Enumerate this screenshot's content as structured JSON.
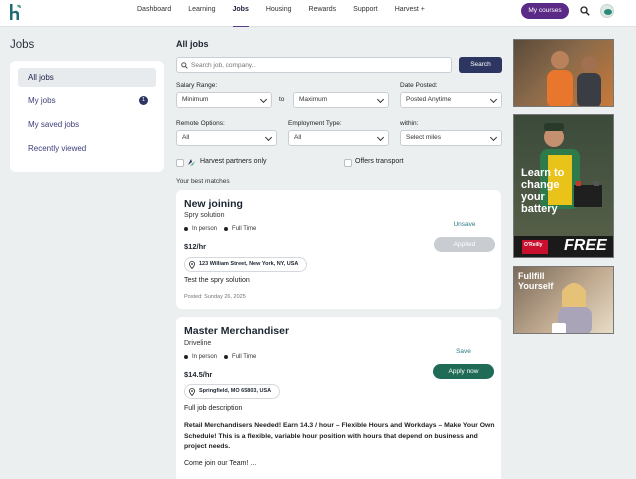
{
  "nav": {
    "items": [
      "Dashboard",
      "Learning",
      "Jobs",
      "Housing",
      "Rewards",
      "Support",
      "Harvest +"
    ],
    "active": "Jobs",
    "my_courses": "My courses"
  },
  "sidebar": {
    "title": "Jobs",
    "items": [
      {
        "label": "All jobs"
      },
      {
        "label": "My jobs",
        "badge": "1"
      },
      {
        "label": "My saved jobs"
      },
      {
        "label": "Recently viewed"
      }
    ]
  },
  "main": {
    "title": "All jobs",
    "search": {
      "placeholder": "Search job, company..",
      "button": "Search"
    },
    "filters": {
      "salary_label": "Salary Range:",
      "salary_min": "Minimum",
      "salary_to": "to",
      "salary_max": "Maximum",
      "date_label": "Date Posted:",
      "date_value": "Posted Anytime",
      "remote_label": "Remote Options:",
      "remote_value": "All",
      "employment_label": "Employment Type:",
      "employment_value": "All",
      "within_label": "within:",
      "within_value": "Select miles",
      "harvest_partners": "Harvest partners only",
      "offers_transport": "Offers transport"
    },
    "best_matches": "Your best matches",
    "jobs": [
      {
        "title": "New joining",
        "company": "Spry solution",
        "tags": [
          "In person",
          "Full Time"
        ],
        "pay": "$12/hr",
        "location": "123 William Street, New York, NY, USA",
        "summary": "Test the spry solution",
        "posted": "Posted: Sunday 26, 2025",
        "save": "Unsave",
        "action": "Applied"
      },
      {
        "title": "Master Merchandiser",
        "company": "Driveline",
        "tags": [
          "In person",
          "Full Time"
        ],
        "pay": "$14.5/hr",
        "location": "Springfield, MO 65803, USA",
        "summary": "Full job description",
        "long": "Retail Merchandisers Needed! Earn 14.3 / hour – Flexible Hours and Workdays – Make Your Own Schedule! This is a flexible, variable hour position with hours that depend on business and project needs.",
        "extra": "Come join our Team! ...",
        "save": "Save",
        "action": "Apply now"
      }
    ]
  },
  "ads": {
    "ad2_text": "Learn to change your battery",
    "ad2_brand": "O'Reilly",
    "ad2_free": "FREE",
    "ad3_text": "Fullfill Yourself"
  },
  "colors": {
    "primary": "#2d3561",
    "brand_purple": "#5b2a86",
    "apply_green": "#1f6b55",
    "link_teal": "#2b7a86"
  }
}
